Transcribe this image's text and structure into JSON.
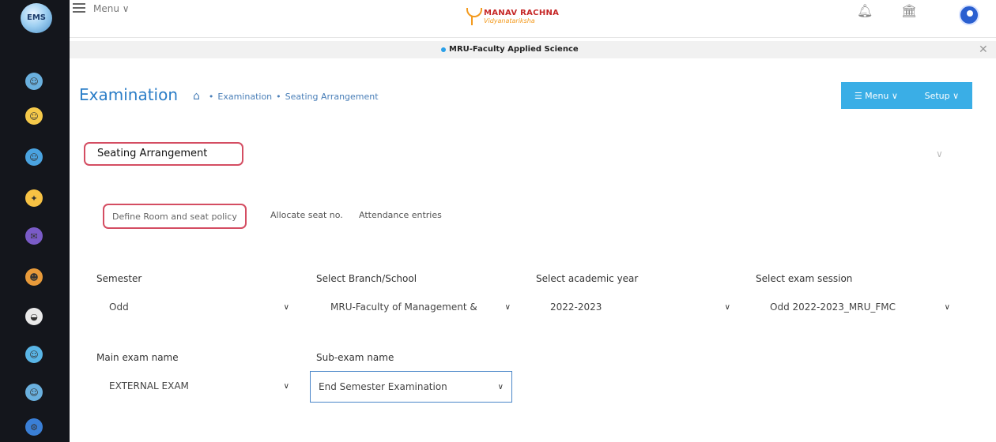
{
  "rail": {
    "logo_text": "EMS"
  },
  "topbar": {
    "menu_label": "Menu ∨"
  },
  "brand": {
    "name": "MANAV RACHNA",
    "tagline": "Vidyanatariksha"
  },
  "org": {
    "name": "MRU-Faculty Applied Science"
  },
  "header": {
    "title": "Examination",
    "breadcrumb": [
      "Examination",
      "Seating Arrangement"
    ],
    "menu_button": "☰ Menu ∨",
    "setup_button": "Setup ∨"
  },
  "panel": {
    "title": "Seating Arrangement"
  },
  "subtabs": [
    "Define Room and seat policy",
    "Allocate seat no.",
    "Attendance entries"
  ],
  "form": {
    "semester": {
      "label": "Semester",
      "value": "Odd"
    },
    "branch": {
      "label": "Select Branch/School",
      "value": "MRU-Faculty of Management &"
    },
    "academic_year": {
      "label": "Select academic year",
      "value": "2022-2023"
    },
    "exam_session": {
      "label": "Select exam session",
      "value": "Odd 2022-2023_MRU_FMC"
    },
    "main_exam": {
      "label": "Main exam name",
      "value": "EXTERNAL EXAM"
    },
    "sub_exam": {
      "label": "Sub-exam name",
      "value": "End Semester Examination"
    }
  },
  "colors": {
    "accent": "#3aaee6",
    "title_blue": "#2a7dc7",
    "highlight_red": "#d44d62",
    "rail_dark": "#14161c"
  }
}
